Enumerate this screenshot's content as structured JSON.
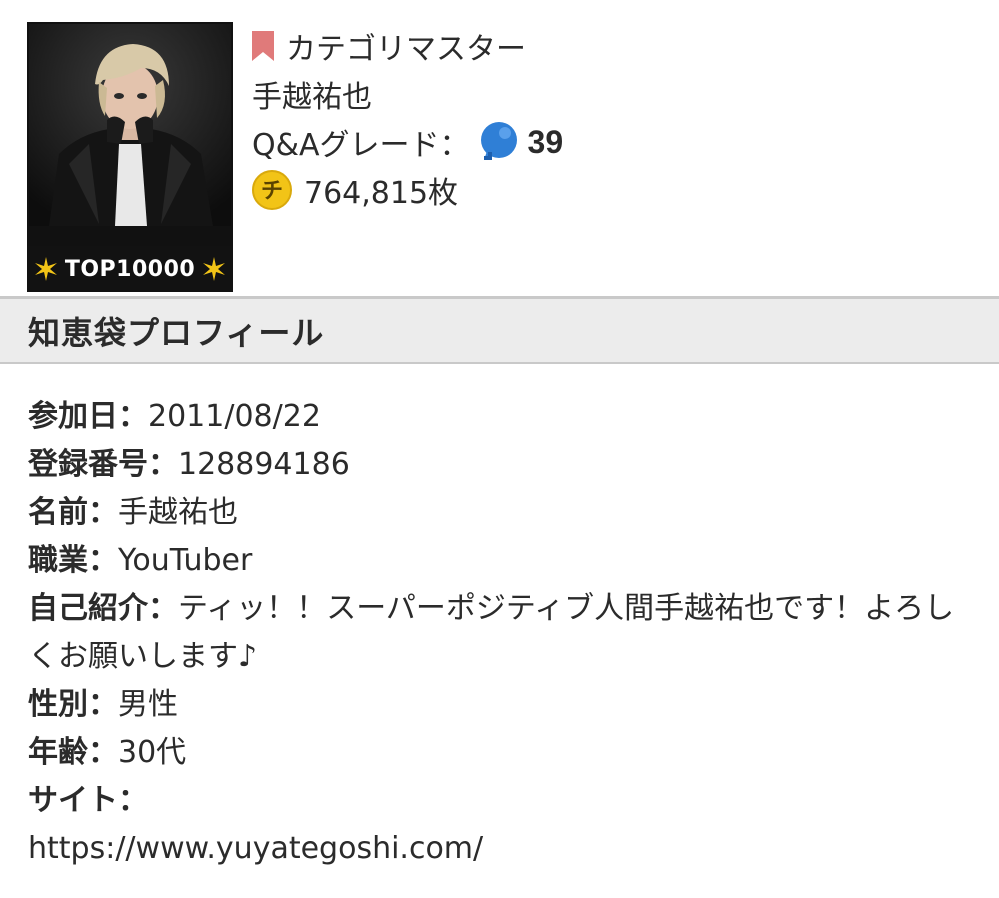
{
  "user": {
    "category_label": "カテゴリマスター",
    "name": "手越祐也",
    "grade_label": "Q&Aグレード：",
    "grade_value": "39",
    "coins": "764,815枚",
    "badge": "TOP10000",
    "coin_glyph": "チ"
  },
  "colors": {
    "bookmark": "#e07a7a",
    "grade_blue": "#2f7fd6",
    "coin_gold": "#f2c417",
    "header_bg": "#ececec"
  },
  "section": {
    "title": "知恵袋プロフィール"
  },
  "profile": [
    {
      "label": "参加日：",
      "value": "2011/08/22"
    },
    {
      "label": "登録番号：",
      "value": "128894186"
    },
    {
      "label": "名前：",
      "value": "手越祐也"
    },
    {
      "label": "職業：",
      "value": "YouTuber"
    },
    {
      "label": "自己紹介：",
      "value": "ティッ！！スーパーポジティブ人間手越祐也です！よろしくお願いします♪"
    },
    {
      "label": "性別：",
      "value": "男性"
    },
    {
      "label": "年齢：",
      "value": "30代"
    },
    {
      "label": "サイト：",
      "value": "https://www.yuyategoshi.com/"
    }
  ]
}
